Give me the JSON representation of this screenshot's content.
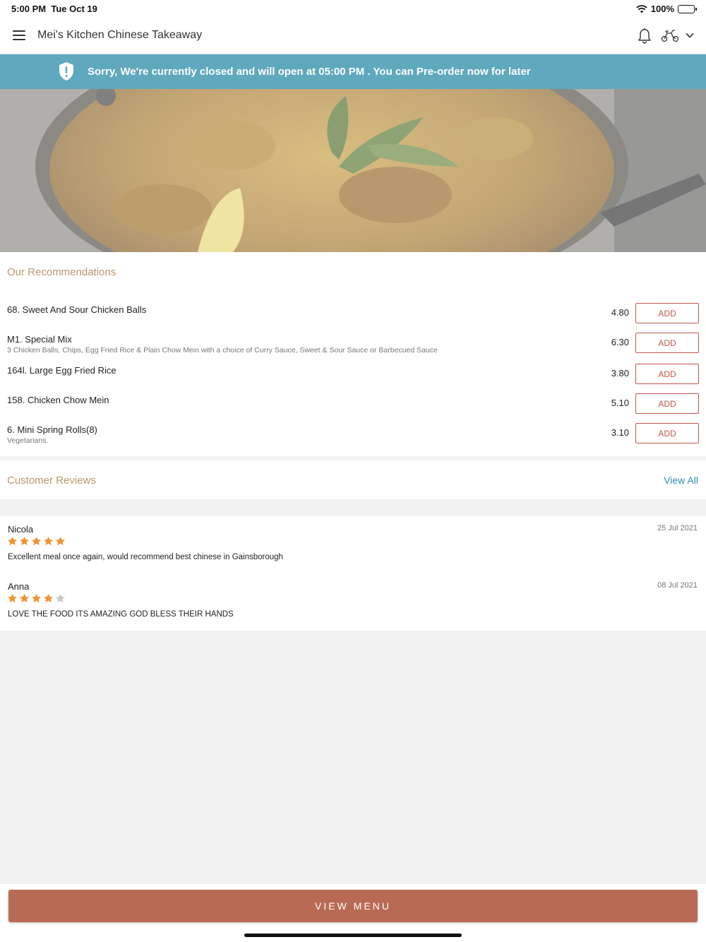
{
  "status_bar": {
    "time": "5:00 PM",
    "date": "Tue Oct 19",
    "battery": "100%"
  },
  "navbar": {
    "title": "Mei's Kitchen Chinese Takeaway",
    "menu_icon": "hamburger-menu-icon",
    "bell_icon": "bell-icon",
    "delivery_icon": "scooter-icon",
    "dropdown_icon": "chevron-down-icon"
  },
  "banner": {
    "message": "Sorry, We're currently closed and will open at 05:00 PM . You can Pre-order now for later",
    "icon": "shield-alert-icon",
    "background": "#5fa8bd"
  },
  "recommendations": {
    "title": "Our Recommendations",
    "items": [
      {
        "name": "68. Sweet And Sour Chicken Balls",
        "description": "",
        "price": "4.80",
        "button": "ADD"
      },
      {
        "name": "M1. Special Mix",
        "description": "3 Chicken Balls, Chips, Egg Fried Rice & Plain Chow Mein with a choice of Curry Sauce, Sweet & Sour Sauce or Barbecued Sauce",
        "price": "6.30",
        "button": "ADD"
      },
      {
        "name": "164l. Large Egg Fried Rice",
        "description": "",
        "price": "3.80",
        "button": "ADD"
      },
      {
        "name": "158. Chicken Chow Mein",
        "description": "",
        "price": "5.10",
        "button": "ADD"
      },
      {
        "name": "6. Mini Spring Rolls(8)",
        "description": "Vegetarians.",
        "price": "3.10",
        "button": "ADD"
      }
    ]
  },
  "reviews": {
    "title": "Customer Reviews",
    "view_all": "View All",
    "items": [
      {
        "name": "Nicola",
        "date": "25 Jul 2021",
        "rating": 5,
        "text": "Excellent meal once again, would recommend best chinese in Gainsborough"
      },
      {
        "name": "Anna",
        "date": "08 Jul 2021",
        "rating": 4,
        "text": "LOVE THE FOOD ITS AMAZING GOD BLESS THEIR  HANDS"
      }
    ]
  },
  "bottom": {
    "view_menu": "VIEW MENU"
  },
  "colors": {
    "accent": "#c0574a",
    "button_bg": "#b96a55",
    "section_title": "#b8986c",
    "link": "#2e8fb0",
    "star": "#f0922e"
  }
}
